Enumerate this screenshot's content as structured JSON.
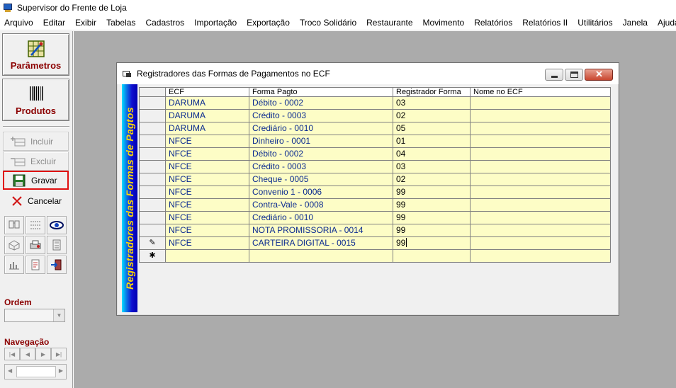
{
  "app": {
    "title": "Supervisor do Frente de Loja"
  },
  "menu": [
    "Arquivo",
    "Editar",
    "Exibir",
    "Tabelas",
    "Cadastros",
    "Importação",
    "Exportação",
    "Troco Solidário",
    "Restaurante",
    "Movimento",
    "Relatórios",
    "Relatórios II",
    "Utilitários",
    "Janela",
    "Ajuda"
  ],
  "sidebar": {
    "parametros_label": "Parâmetros",
    "produtos_label": "Produtos",
    "incluir_label": "Incluir",
    "excluir_label": "Excluir",
    "gravar_label": "Gravar",
    "cancelar_label": "Cancelar",
    "ordem_label": "Ordem",
    "navegacao_label": "Navegação"
  },
  "window": {
    "title": "Registradores das Formas de Pagamentos no ECF",
    "banner": "Registradores das Formas de Pagtos",
    "columns": [
      "ECF",
      "Forma Pagto",
      "Registrador Forma",
      "Nome no ECF"
    ],
    "rows": [
      {
        "ecf": "DARUMA",
        "forma": "Débito  -  0002",
        "reg": "03",
        "nome": ""
      },
      {
        "ecf": "DARUMA",
        "forma": "Crédito  -  0003",
        "reg": "02",
        "nome": ""
      },
      {
        "ecf": "DARUMA",
        "forma": "Crediário  -  0010",
        "reg": "05",
        "nome": ""
      },
      {
        "ecf": "NFCE",
        "forma": "Dinheiro  -  0001",
        "reg": "01",
        "nome": ""
      },
      {
        "ecf": "NFCE",
        "forma": "Débito  -  0002",
        "reg": "04",
        "nome": ""
      },
      {
        "ecf": "NFCE",
        "forma": "Crédito  -  0003",
        "reg": "03",
        "nome": ""
      },
      {
        "ecf": "NFCE",
        "forma": "Cheque  -  0005",
        "reg": "02",
        "nome": ""
      },
      {
        "ecf": "NFCE",
        "forma": "Convenio 1  -  0006",
        "reg": "99",
        "nome": ""
      },
      {
        "ecf": "NFCE",
        "forma": "Contra-Vale  -  0008",
        "reg": "99",
        "nome": ""
      },
      {
        "ecf": "NFCE",
        "forma": "Crediário  -  0010",
        "reg": "99",
        "nome": ""
      },
      {
        "ecf": "NFCE",
        "forma": "NOTA PROMISSORIA  -  0014",
        "reg": "99",
        "nome": ""
      },
      {
        "ecf": "NFCE",
        "forma": "CARTEIRA DIGITAL  -  0015",
        "reg": "99",
        "nome": ""
      }
    ],
    "edit_indicator": "✎",
    "new_indicator": "✱"
  },
  "colors": {
    "row_bg": "#fdfdc6",
    "text_blue": "#0a2a90",
    "label_red": "#8b0000",
    "highlight": "#e01010"
  }
}
